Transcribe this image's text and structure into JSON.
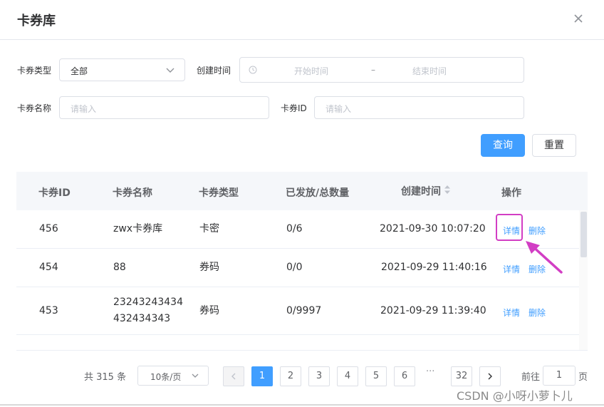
{
  "dialog": {
    "title": "卡券库"
  },
  "filters": {
    "type_label": "卡券类型",
    "type_value": "全部",
    "created_label": "创建时间",
    "start_placeholder": "开始时间",
    "range_separator": "–",
    "end_placeholder": "结束时间",
    "name_label": "卡券名称",
    "name_placeholder": "请输入",
    "id_label": "卡券ID",
    "id_placeholder": "请输入",
    "search_label": "查询",
    "reset_label": "重置"
  },
  "table": {
    "headers": {
      "id": "卡券ID",
      "name": "卡券名称",
      "type": "卡券类型",
      "issued": "已发放/总数量",
      "created": "创建时间",
      "actions": "操作"
    },
    "rows": [
      {
        "id": "456",
        "name_line1": "zwx卡券库",
        "name_line2": "",
        "type": "卡密",
        "issued": "0/6",
        "created": "2021-09-30 10:07:20",
        "detail": "详情",
        "delete": "删除"
      },
      {
        "id": "454",
        "name_line1": "88",
        "name_line2": "",
        "type": "券码",
        "issued": "0/0",
        "created": "2021-09-29 11:40:16",
        "detail": "详情",
        "delete": "删除"
      },
      {
        "id": "453",
        "name_line1": "23243243434",
        "name_line2": "432434343",
        "type": "券码",
        "issued": "0/9997",
        "created": "2021-09-29 11:39:40",
        "detail": "详情",
        "delete": "删除"
      }
    ]
  },
  "pagination": {
    "total_text": "共 315 条",
    "page_size": "10条/页",
    "pages": [
      "1",
      "2",
      "3",
      "4",
      "5",
      "6"
    ],
    "current": "1",
    "ellipsis": "···",
    "last": "32",
    "goto_label": "前往",
    "goto_value": "1",
    "page_suffix": "页"
  },
  "watermark": "CSDN @小呀小萝卜儿",
  "colors": {
    "primary": "#409eff",
    "highlight": "#d23ec4",
    "border": "#dcdfe6"
  }
}
